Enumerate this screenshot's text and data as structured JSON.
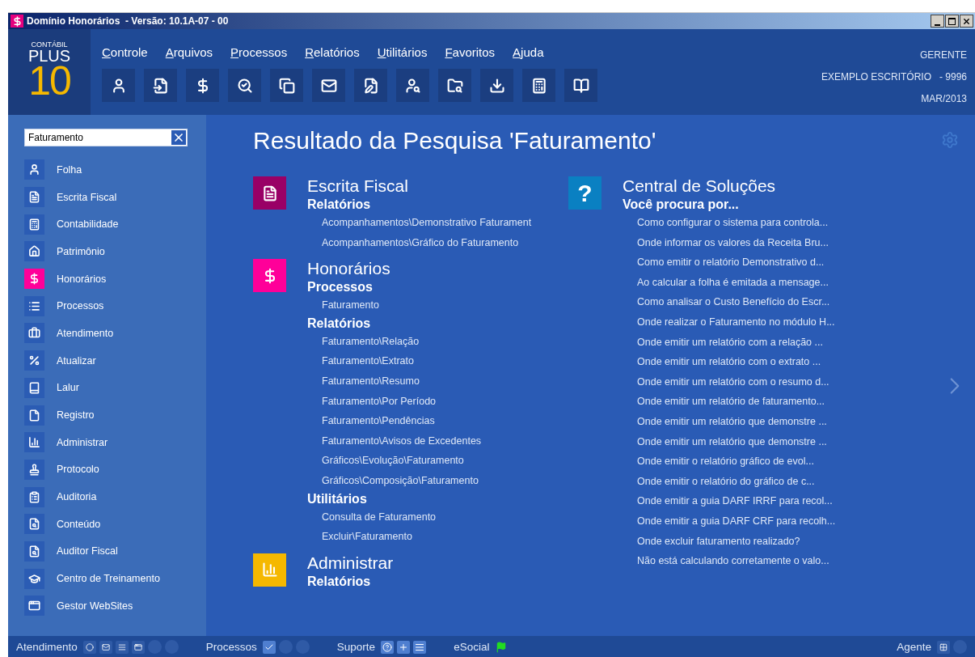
{
  "window": {
    "title": "Domínio Honorários  - Versão: 10.1A-07 - 00"
  },
  "logo": {
    "top": "CONTÁBIL",
    "middle": "PLUS",
    "number": "10"
  },
  "menu": [
    "Controle",
    "Arquivos",
    "Processos",
    "Relatórios",
    "Utilitários",
    "Favoritos",
    "Ajuda"
  ],
  "user_info": [
    "GERENTE",
    "EXEMPLO ESCRITÓRIO   - 9996",
    "MAR/2013"
  ],
  "search": {
    "value": "Faturamento"
  },
  "sidebar": {
    "items": [
      {
        "label": "Folha",
        "selected": false
      },
      {
        "label": "Escrita Fiscal",
        "selected": false
      },
      {
        "label": "Contabilidade",
        "selected": false
      },
      {
        "label": "Patrimônio",
        "selected": false
      },
      {
        "label": "Honorários",
        "selected": true
      },
      {
        "label": "Processos",
        "selected": false
      },
      {
        "label": "Atendimento",
        "selected": false
      },
      {
        "label": "Atualizar",
        "selected": false
      },
      {
        "label": "Lalur",
        "selected": false
      },
      {
        "label": "Registro",
        "selected": false
      },
      {
        "label": "Administrar",
        "selected": false
      },
      {
        "label": "Protocolo",
        "selected": false
      },
      {
        "label": "Auditoria",
        "selected": false
      },
      {
        "label": "Conteúdo",
        "selected": false
      },
      {
        "label": "Auditor Fiscal",
        "selected": false
      },
      {
        "label": "Centro de Treinamento",
        "selected": false
      },
      {
        "label": "Gestor WebSites",
        "selected": false
      }
    ]
  },
  "results": {
    "title": "Resultado da Pesquisa 'Faturamento'",
    "sections": [
      {
        "title": "Escrita Fiscal",
        "color": "#990066",
        "groups": [
          {
            "heading": "Relatórios",
            "links": [
              "Acompanhamentos\\Demonstrativo Faturament",
              "Acompanhamentos\\Gráfico do Faturamento"
            ]
          }
        ]
      },
      {
        "title": "Honorários",
        "color": "#ff0099",
        "groups": [
          {
            "heading": "Processos",
            "links": [
              "Faturamento"
            ]
          },
          {
            "heading": "Relatórios",
            "links": [
              "Faturamento\\Relação",
              "Faturamento\\Extrato",
              "Faturamento\\Resumo",
              "Faturamento\\Por Período",
              "Faturamento\\Pendências",
              "Faturamento\\Avisos de Excedentes",
              "Gráficos\\Evolução\\Faturamento",
              "Gráficos\\Composição\\Faturamento"
            ]
          },
          {
            "heading": "Utilitários",
            "links": [
              "Consulta de Faturamento",
              "Excluir\\Faturamento"
            ]
          }
        ]
      },
      {
        "title": "Administrar",
        "color": "#f5b800",
        "groups": [
          {
            "heading": "Relatórios"
          }
        ]
      }
    ],
    "solutions": {
      "icon_text": "?",
      "title": "Central de Soluções",
      "heading": "Você procura por...",
      "links": [
        "Como configurar o sistema para controla...",
        "Onde informar os valores da Receita Bru...",
        "Como emitir o relatório Demonstrativo d...",
        "Ao calcular a folha é emitada a mensage...",
        "Como analisar o Custo Benefício do Escr...",
        "Onde realizar o Faturamento no módulo H...",
        "Onde emitir um relatório com a relação ...",
        "Onde emitir um relatório com o extrato ...",
        "Onde emitir um relatório com o resumo d...",
        "Onde emitir um relatório de faturamento...",
        "Onde emitir um relatório que demonstre ...",
        "Onde emitir um relatório que demonstre ...",
        "Onde emitir o relatório gráfico de evol...",
        "Onde emitir o relatório do gráfico de c...",
        "Onde emitir a guia DARF IRRF para recol...",
        "Onde emitir a guia DARF CRF para recolh...",
        "Onde excluir faturamento realizado?",
        "Não está calculando corretamente o valo..."
      ]
    }
  },
  "status_bar": [
    "Atendimento",
    "Processos",
    "Suporte",
    "eSocial",
    "Agente"
  ]
}
